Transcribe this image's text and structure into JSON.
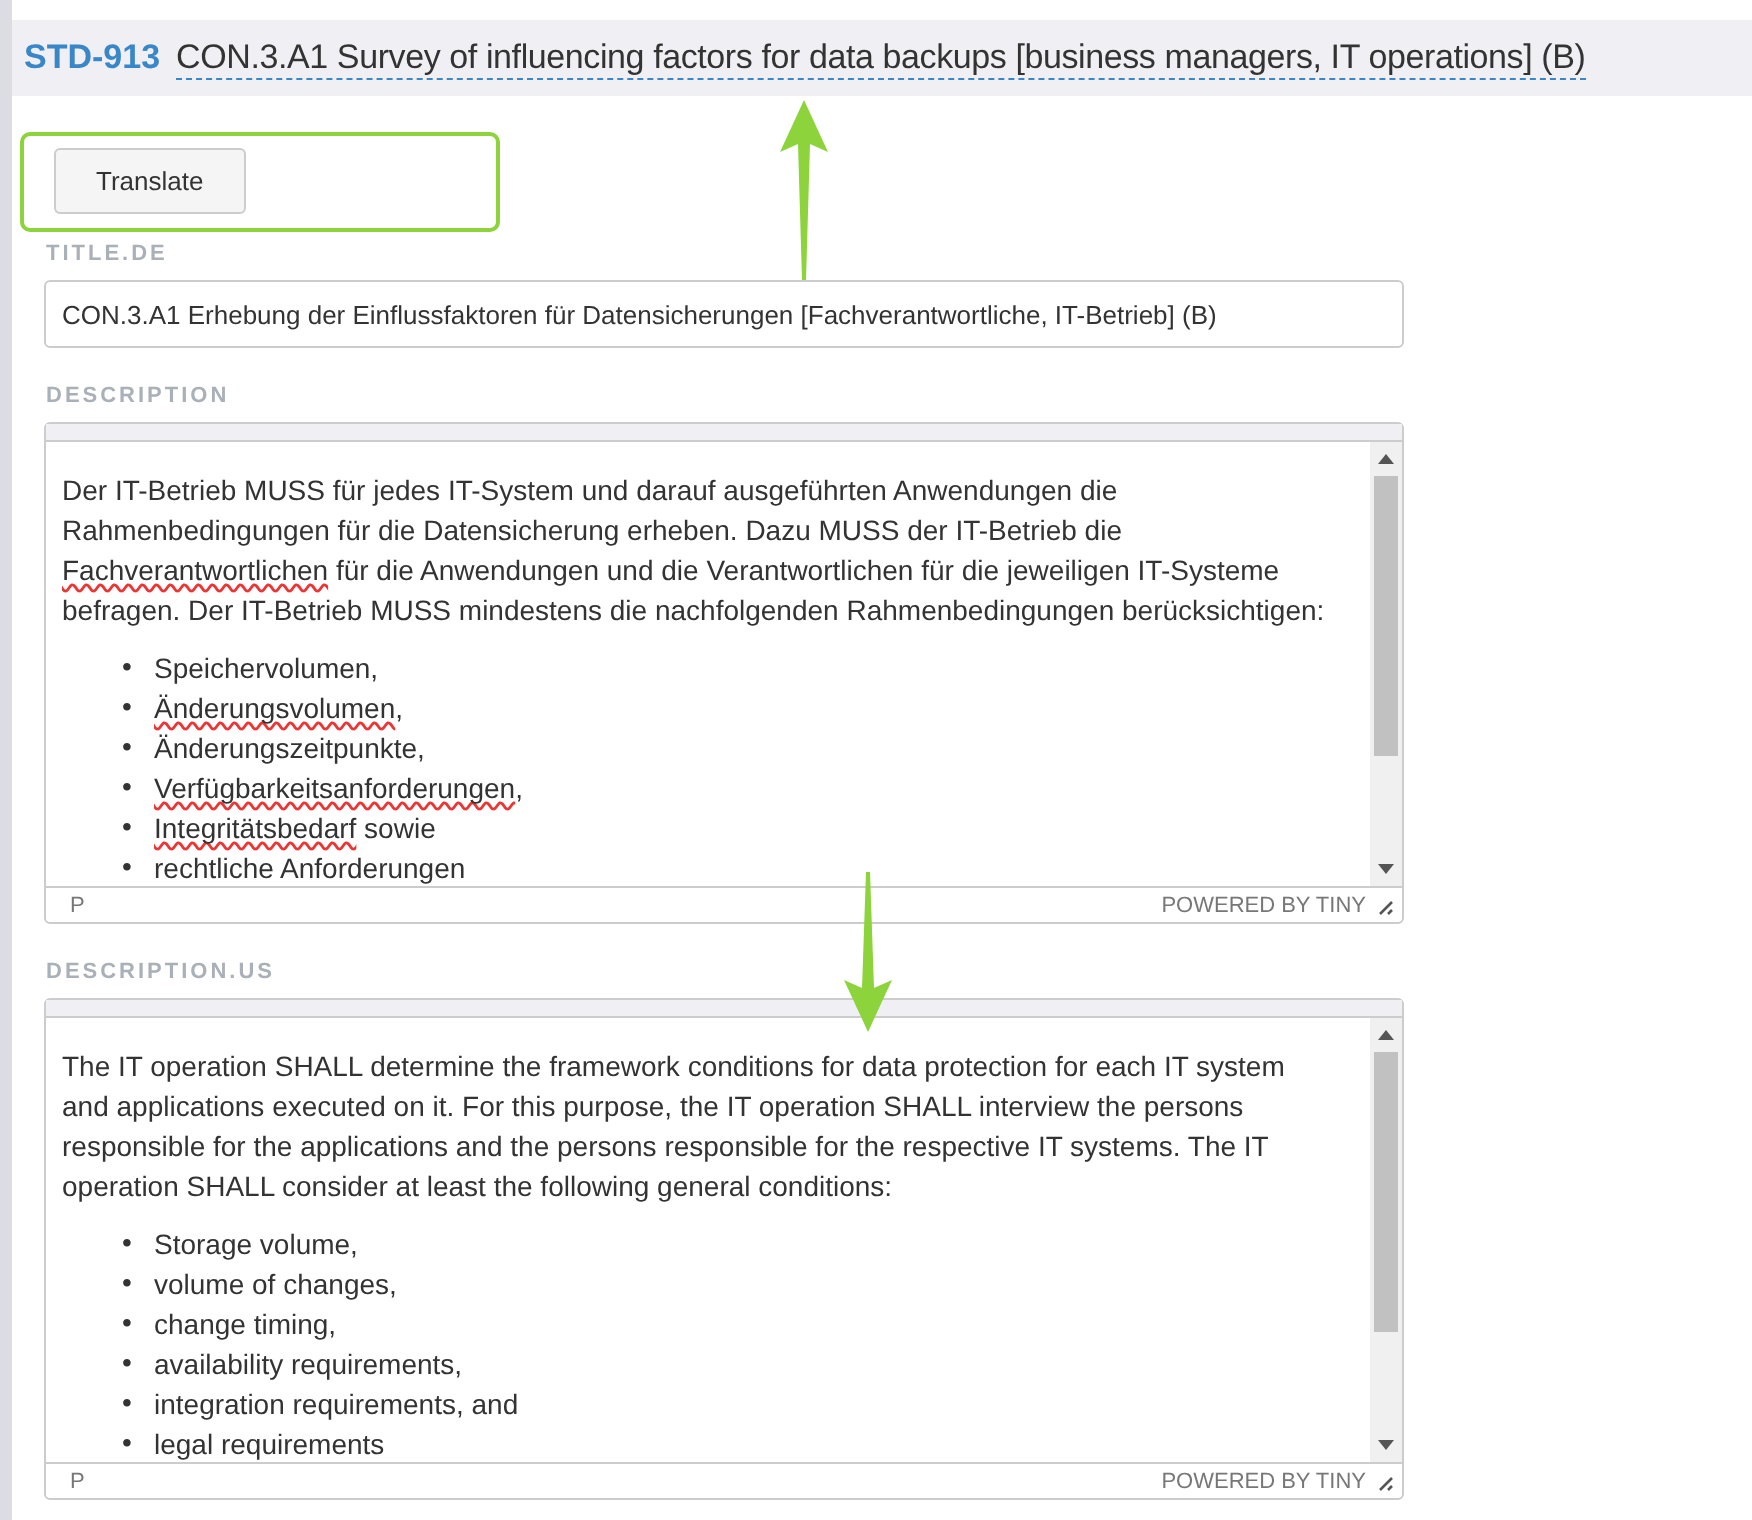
{
  "header": {
    "id": "STD-913",
    "title": "CON.3.A1 Survey of influencing factors for data backups [business managers, IT operations] (B)"
  },
  "translate_button": {
    "label": "Translate"
  },
  "title_de": {
    "label": "TITLE.DE",
    "value": "CON.3.A1 Erhebung der Einflussfaktoren für Datensicherungen [Fachverantwortliche, IT-Betrieb] (B)"
  },
  "editors": [
    {
      "label": "DESCRIPTION",
      "paragraph": [
        {
          "text": "Der IT-Betrieb MUSS für jedes IT-System und darauf ausgeführten Anwendungen die Rahmenbedingungen für die Datensicherung erheben. Dazu MUSS der IT-Betrieb die ",
          "misspelled": false
        },
        {
          "text": "Fachverantwortlichen",
          "misspelled": true
        },
        {
          "text": " für die Anwendungen und die Verantwortlichen für die jeweiligen IT-Systeme befragen. Der IT-Betrieb MUSS mindestens die nachfolgenden Rahmenbedingungen berücksichtigen:",
          "misspelled": false
        }
      ],
      "items": [
        {
          "bullet": "•",
          "parts": [
            {
              "text": "Speichervolumen,",
              "misspelled": false
            }
          ]
        },
        {
          "bullet": "•",
          "parts": [
            {
              "text": "Änderungsvolumen",
              "misspelled": true
            },
            {
              "text": ",",
              "misspelled": false
            }
          ]
        },
        {
          "bullet": "•",
          "parts": [
            {
              "text": "Änderungszeitpunkte,",
              "misspelled": false
            }
          ]
        },
        {
          "bullet": "•",
          "parts": [
            {
              "text": "Verfügbarkeitsanforderungen",
              "misspelled": true
            },
            {
              "text": ",",
              "misspelled": false
            }
          ]
        },
        {
          "bullet": "•",
          "parts": [
            {
              "text": "Integritätsbedarf",
              "misspelled": true
            },
            {
              "text": " sowie",
              "misspelled": false
            }
          ]
        },
        {
          "bullet": "•",
          "parts": [
            {
              "text": "rechtliche Anforderungen",
              "misspelled": false
            }
          ]
        }
      ],
      "path": "P",
      "branding": "POWERED BY TINY"
    },
    {
      "label": "DESCRIPTION.US",
      "paragraph": [
        {
          "text": "The IT operation SHALL determine the framework conditions for data protection for each IT system and applications executed on it. For this purpose, the IT operation SHALL interview the persons responsible for the applications and the persons responsible for the respective IT systems. The IT operation SHALL consider at least the following general conditions:",
          "misspelled": false
        }
      ],
      "items": [
        {
          "bullet": "•",
          "parts": [
            {
              "text": "Storage volume,",
              "misspelled": false
            }
          ]
        },
        {
          "bullet": "•",
          "parts": [
            {
              "text": "volume of changes,",
              "misspelled": false
            }
          ]
        },
        {
          "bullet": "•",
          "parts": [
            {
              "text": "change timing,",
              "misspelled": false
            }
          ]
        },
        {
          "bullet": "•",
          "parts": [
            {
              "text": "availability requirements,",
              "misspelled": false
            }
          ]
        },
        {
          "bullet": "•",
          "parts": [
            {
              "text": "integration requirements, and",
              "misspelled": false
            }
          ]
        },
        {
          "bullet": "•",
          "parts": [
            {
              "text": "legal requirements",
              "misspelled": false
            }
          ]
        }
      ],
      "path": "P",
      "branding": "POWERED BY TINY"
    }
  ]
}
